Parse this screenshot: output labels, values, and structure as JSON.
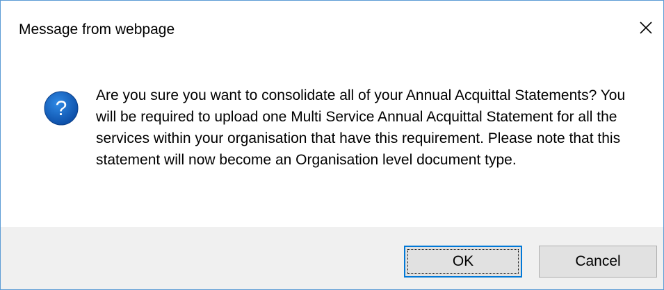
{
  "window": {
    "title": "Message from webpage"
  },
  "icons": {
    "close": "close-icon",
    "message": "question-icon"
  },
  "message": {
    "text": "Are you sure you want to consolidate all of your Annual Acquittal Statements? You will be required to upload one Multi Service Annual Acquittal Statement for all the services within your organisation that have this requirement. Please note that this statement will now become an Organisation level document type."
  },
  "buttons": {
    "ok_label": "OK",
    "cancel_label": "Cancel"
  },
  "colors": {
    "accent": "#0078d7",
    "icon_blue": "#1565c0",
    "footer_bg": "#f0f0f0"
  }
}
